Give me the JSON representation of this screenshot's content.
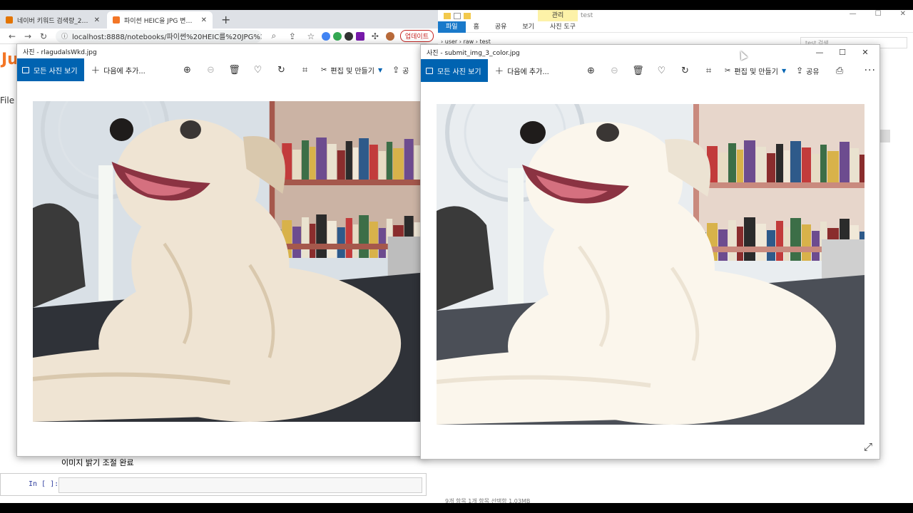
{
  "browser": {
    "tabs": [
      {
        "title": "네이버 키워드 검색량_2022042...",
        "icon_color": "#e37400",
        "active": false
      },
      {
        "title": "파이썬 HEIC을 JPG 변환후 이미...",
        "icon_color": "#f37626",
        "active": true
      }
    ],
    "new_tab": "+",
    "url": "localhost:8888/notebooks/파이썬%20HEIC를%20JPG%20...",
    "update_label": "업데이트",
    "jupyter_logo": "Ju",
    "menu_file": "File",
    "notebook_output": "이미지 밝기 조절 완료",
    "cell_prompt": "In [ ]:"
  },
  "explorer": {
    "manage_tab": "관리",
    "title": "test",
    "ribbon": [
      "파일",
      "홈",
      "공유",
      "보기",
      "사진 도구"
    ],
    "address": "›  user  ›  raw  ›  test",
    "search_placeholder": "test 검색",
    "status": "9개 항목      1개 항목 선택함 1.03MB"
  },
  "photos_left": {
    "title": "사진 - rlagudalsWkd.jpg",
    "all_photos": "모든 사진 보기",
    "add_to": "다음에 추가...",
    "edit_create": "편집 및 만들기",
    "share": "공유"
  },
  "photos_right": {
    "title": "사진 - submit_img_3_color.jpg",
    "all_photos": "모든 사진 보기",
    "add_to": "다음에 추가...",
    "edit_create": "편집 및 만들기",
    "share": "공유"
  },
  "colors": {
    "accent": "#0063b1",
    "explorer_file_tab": "#1979ca",
    "manage_highlight": "#fdf2a8"
  }
}
